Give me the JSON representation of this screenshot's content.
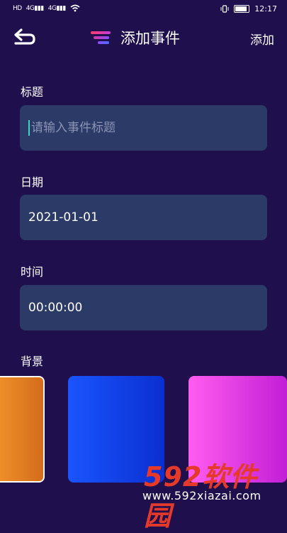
{
  "status_bar": {
    "left_icons": [
      "HD",
      "4G",
      "4G",
      "wifi"
    ],
    "time": "12:17"
  },
  "header": {
    "title": "添加事件",
    "action_label": "添加",
    "colors": {
      "logo_gradient": [
        "#ff3b6b",
        "#6b4cff"
      ]
    }
  },
  "form": {
    "title_field": {
      "label": "标题",
      "value": "",
      "placeholder": "请输入事件标题"
    },
    "date_field": {
      "label": "日期",
      "value": "2021-01-01"
    },
    "time_field": {
      "label": "时间",
      "value": "00:00:00"
    },
    "background": {
      "label": "背景",
      "swatches": [
        {
          "name": "orange",
          "colors": [
            "#f0922a",
            "#d46c1a"
          ],
          "selected": true
        },
        {
          "name": "blue",
          "colors": [
            "#1a55ff",
            "#0a2fd0"
          ],
          "selected": false
        },
        {
          "name": "pink",
          "colors": [
            "#ff5cf0",
            "#c21fd6"
          ],
          "selected": false
        }
      ]
    }
  },
  "watermark": {
    "brand": "592",
    "brand_cn": "软件园",
    "url": "www.592xiazai.com"
  }
}
